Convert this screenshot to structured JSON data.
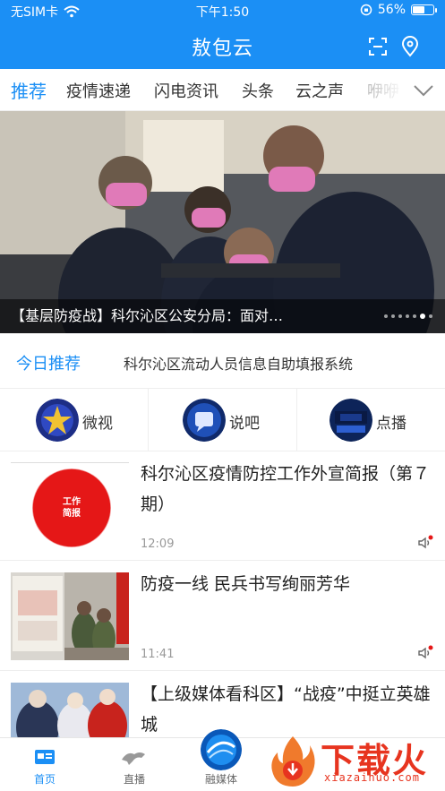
{
  "status": {
    "carrier": "无SIM卡",
    "time": "下午1:50",
    "battery": "56%",
    "battery_level": 0.56
  },
  "header": {
    "title": "敖包云",
    "scan_icon": "scan-icon",
    "location_icon": "location-pin-icon"
  },
  "tabs": [
    {
      "label": "推荐",
      "active": true
    },
    {
      "label": "疫情速递"
    },
    {
      "label": "闪电资讯"
    },
    {
      "label": "头条"
    },
    {
      "label": "云之声"
    },
    {
      "label": "咿咿"
    }
  ],
  "banner": {
    "caption": "【基层防疫战】科尔沁区公安分局：面对…",
    "slide_count": 7,
    "active_slide": 6
  },
  "today": {
    "label": "今日推荐",
    "text": "科尔沁区流动人员信息自助填报系统"
  },
  "quick": [
    {
      "label": "微视",
      "logo_text": "微视"
    },
    {
      "label": "说吧",
      "logo_text": "说"
    },
    {
      "label": "点播",
      "logo_text": "点播"
    }
  ],
  "news": [
    {
      "title": "科尔沁区疫情防控工作外宣简报（第７期）",
      "time": "12:09",
      "badge_line1": "工作",
      "badge_line2": "简报"
    },
    {
      "title": "防疫一线 民兵书写绚丽芳华",
      "time": "11:41"
    },
    {
      "title": "【上级媒体看科区】“战疫”中挺立英雄城",
      "time": ""
    }
  ],
  "bottomnav": [
    {
      "label": "首页",
      "active": true
    },
    {
      "label": "直播"
    },
    {
      "label": "融媒体"
    }
  ],
  "watermark": {
    "text": "下载火",
    "url": "xiazaihuo.com"
  },
  "colors": {
    "brand_blue": "#1b8ff5",
    "badge_red": "#e51717",
    "watermark_red": "#e7341f"
  }
}
